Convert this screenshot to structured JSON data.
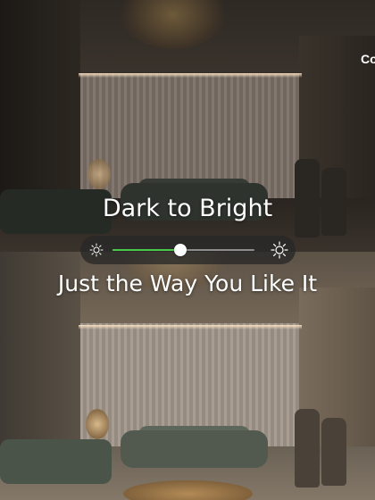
{
  "headline": {
    "top": "Dark to Bright",
    "bottom": "Just the Way You Like It"
  },
  "corner_text": "Co",
  "brightness_slider": {
    "value_fraction": 0.48,
    "min_icon": "sun-small-icon",
    "max_icon": "sun-large-icon",
    "fill_color": "#48c948",
    "track_color": "#8d8d8d",
    "thumb_color": "#ffffff"
  },
  "scenes": [
    {
      "name": "dim-room",
      "lighting": "dark"
    },
    {
      "name": "lit-room",
      "lighting": "bright"
    }
  ]
}
